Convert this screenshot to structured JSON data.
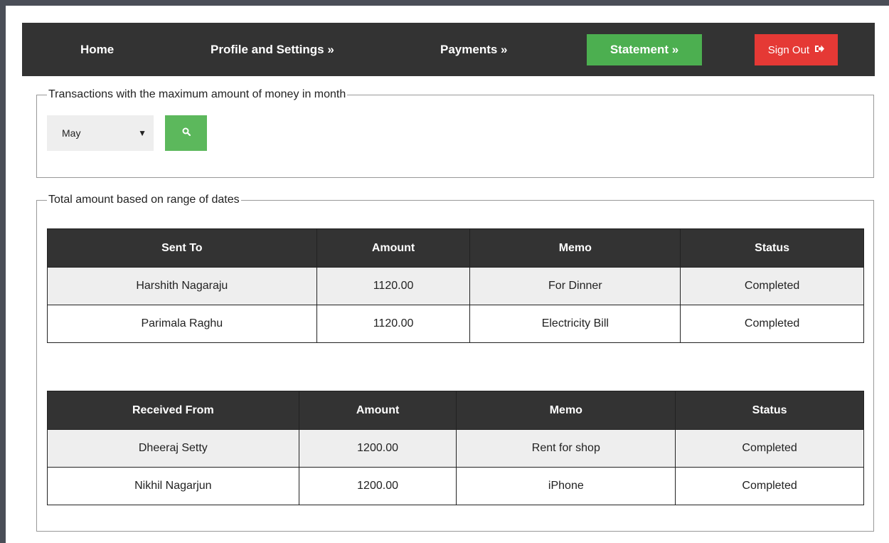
{
  "nav": {
    "home": "Home",
    "profile": "Profile and Settings »",
    "payments": "Payments »",
    "statement": "Statement »",
    "signout": "Sign Out",
    "signout_icon": "sign-out-icon"
  },
  "max_section": {
    "legend": "Transactions with the maximum amount of money in month",
    "month_value": "May",
    "search_icon": "search-icon"
  },
  "range_section": {
    "legend": "Total amount based on range of dates"
  },
  "sent_table": {
    "headers": [
      "Sent To",
      "Amount",
      "Memo",
      "Status"
    ],
    "rows": [
      [
        "Harshith Nagaraju",
        "1120.00",
        "For Dinner",
        "Completed"
      ],
      [
        "Parimala Raghu",
        "1120.00",
        "Electricity Bill",
        "Completed"
      ]
    ]
  },
  "received_table": {
    "headers": [
      "Received From",
      "Amount",
      "Memo",
      "Status"
    ],
    "rows": [
      [
        "Dheeraj Setty",
        "1200.00",
        "Rent for shop",
        "Completed"
      ],
      [
        "Nikhil Nagarjun",
        "1200.00",
        "iPhone",
        "Completed"
      ]
    ]
  },
  "colors": {
    "navbar": "#333333",
    "statement_button": "#4caf50",
    "signout_button": "#e53935",
    "search_button": "#5cb85c",
    "frame": "#4a4e57"
  }
}
